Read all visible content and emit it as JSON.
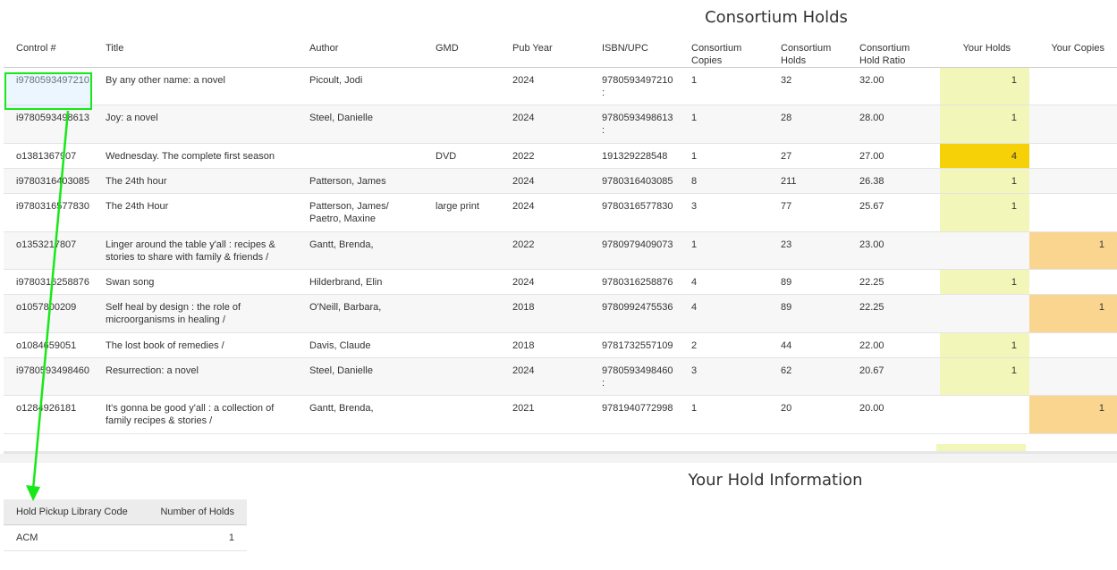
{
  "consortium": {
    "title": "Consortium Holds",
    "headers": {
      "control": "Control #",
      "title": "Title",
      "author": "Author",
      "gmd": "GMD",
      "pub_year": "Pub Year",
      "isbn": "ISBN/UPC",
      "copies": [
        "Consortium",
        "Copies"
      ],
      "holds": [
        "Consortium",
        "Holds"
      ],
      "ratio": [
        "Consortium",
        "Hold Ratio"
      ],
      "your_holds": "Your Holds",
      "your_copies": "Your Copies"
    },
    "rows": [
      {
        "control": "i9780593497210",
        "title": [
          "By any other name:   a novel"
        ],
        "author": [
          "Picoult, Jodi"
        ],
        "gmd": "",
        "year": "2024",
        "isbn": [
          "9780593497210",
          ":"
        ],
        "copies": "1",
        "holds": "32",
        "ratio": "32.00",
        "your_holds": "1",
        "your_copies": ""
      },
      {
        "control": "i9780593498613",
        "title": [
          "Joy:   a novel"
        ],
        "author": [
          "Steel, Danielle"
        ],
        "gmd": "",
        "year": "2024",
        "isbn": [
          "9780593498613",
          ":"
        ],
        "copies": "1",
        "holds": "28",
        "ratio": "28.00",
        "your_holds": "1",
        "your_copies": ""
      },
      {
        "control": "o1381367907",
        "title": [
          "Wednesday. The complete first season"
        ],
        "author": [
          ""
        ],
        "gmd": "DVD",
        "year": "2022",
        "isbn": [
          "191329228548"
        ],
        "copies": "1",
        "holds": "27",
        "ratio": "27.00",
        "your_holds": "4",
        "your_copies": ""
      },
      {
        "control": "i9780316403085",
        "title": [
          "The 24th hour"
        ],
        "author": [
          "Patterson, James"
        ],
        "gmd": "",
        "year": "2024",
        "isbn": [
          "9780316403085"
        ],
        "copies": "8",
        "holds": "211",
        "ratio": "26.38",
        "your_holds": "1",
        "your_copies": ""
      },
      {
        "control": "i9780316577830",
        "title": [
          "The 24th Hour"
        ],
        "author": [
          "Patterson, James/",
          "Paetro, Maxine"
        ],
        "gmd": "large print",
        "year": "2024",
        "isbn": [
          "9780316577830"
        ],
        "copies": "3",
        "holds": "77",
        "ratio": "25.67",
        "your_holds": "1",
        "your_copies": ""
      },
      {
        "control": "o1353217807",
        "title": [
          "Linger around the table y'all :  recipes &",
          "stories to share with family & friends /"
        ],
        "author": [
          "Gantt, Brenda,"
        ],
        "gmd": "",
        "year": "2022",
        "isbn": [
          "9780979409073"
        ],
        "copies": "1",
        "holds": "23",
        "ratio": "23.00",
        "your_holds": "",
        "your_copies": "1"
      },
      {
        "control": "i9780316258876",
        "title": [
          "Swan song"
        ],
        "author": [
          "Hilderbrand, Elin"
        ],
        "gmd": "",
        "year": "2024",
        "isbn": [
          "9780316258876"
        ],
        "copies": "4",
        "holds": "89",
        "ratio": "22.25",
        "your_holds": "1",
        "your_copies": ""
      },
      {
        "control": "o1057800209",
        "title": [
          "Self heal by design :  the role of",
          "microorganisms in healing /"
        ],
        "author": [
          "O'Neill, Barbara,"
        ],
        "gmd": "",
        "year": "2018",
        "isbn": [
          "9780992475536"
        ],
        "copies": "4",
        "holds": "89",
        "ratio": "22.25",
        "your_holds": "",
        "your_copies": "1"
      },
      {
        "control": "o1084659051",
        "title": [
          "The lost book of remedies /"
        ],
        "author": [
          "Davis, Claude"
        ],
        "gmd": "",
        "year": "2018",
        "isbn": [
          "9781732557109"
        ],
        "copies": "2",
        "holds": "44",
        "ratio": "22.00",
        "your_holds": "1",
        "your_copies": ""
      },
      {
        "control": "i9780593498460",
        "title": [
          "Resurrection:   a novel"
        ],
        "author": [
          "Steel, Danielle"
        ],
        "gmd": "",
        "year": "2024",
        "isbn": [
          "9780593498460",
          ":"
        ],
        "copies": "3",
        "holds": "62",
        "ratio": "20.67",
        "your_holds": "1",
        "your_copies": ""
      },
      {
        "control": "o1284926181",
        "title": [
          "It's gonna be good y'all :  a collection of",
          "family recipes & stories /"
        ],
        "author": [
          "Gantt, Brenda,"
        ],
        "gmd": "",
        "year": "2021",
        "isbn": [
          "9781940772998"
        ],
        "copies": "1",
        "holds": "20",
        "ratio": "20.00",
        "your_holds": "",
        "your_copies": "1"
      }
    ]
  },
  "your_hold_info": {
    "title": "Your Hold Information",
    "headers": {
      "library_code": "Hold Pickup Library Code",
      "number_of_holds": "Number of Holds"
    },
    "rows": [
      {
        "library_code": "ACM",
        "number_of_holds": "1"
      }
    ]
  },
  "colors": {
    "highlight_arrow": "#18e818",
    "your_holds_fill": "#f2f6b8",
    "your_holds_strong": "#f7d108",
    "your_copies_fill": "#fad58f"
  }
}
